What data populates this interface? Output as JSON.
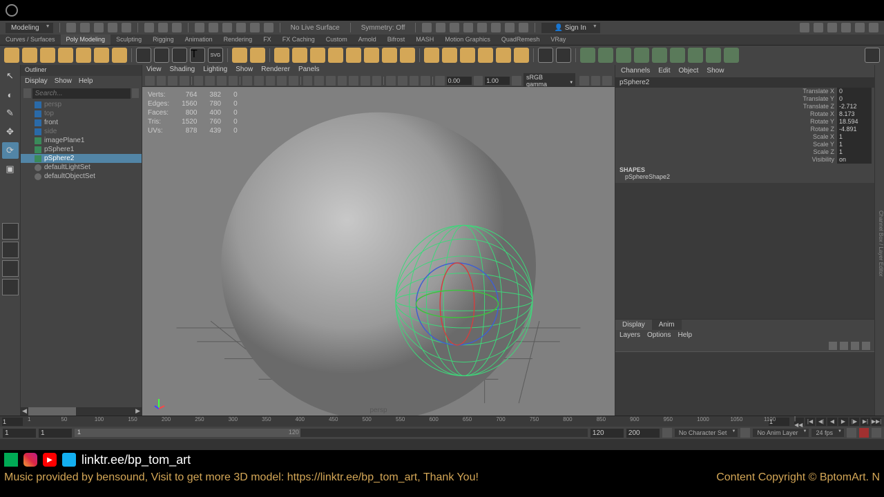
{
  "menubar": {
    "workspace": "Modeling",
    "liveSurface": "No Live Surface",
    "symmetry": "Symmetry: Off",
    "signIn": "Sign In"
  },
  "shelfTabs": [
    "Curves / Surfaces",
    "Poly Modeling",
    "Sculpting",
    "Rigging",
    "Animation",
    "Rendering",
    "FX",
    "FX Caching",
    "Custom",
    "Arnold",
    "Bifrost",
    "MASH",
    "Motion Graphics",
    "QuadRemesh",
    "VRay"
  ],
  "activeShelfTab": 1,
  "outliner": {
    "title": "Outliner",
    "menu": [
      "Display",
      "Show",
      "Help"
    ],
    "searchPlaceholder": "Search...",
    "items": [
      {
        "label": "persp",
        "type": "cam",
        "dim": true
      },
      {
        "label": "top",
        "type": "cam",
        "dim": true
      },
      {
        "label": "front",
        "type": "cam",
        "dim": false
      },
      {
        "label": "side",
        "type": "cam",
        "dim": true
      },
      {
        "label": "imagePlane1",
        "type": "mesh",
        "dim": false
      },
      {
        "label": "pSphere1",
        "type": "mesh",
        "dim": false
      },
      {
        "label": "pSphere2",
        "type": "mesh",
        "dim": false,
        "sel": true
      },
      {
        "label": "defaultLightSet",
        "type": "set",
        "dim": false
      },
      {
        "label": "defaultObjectSet",
        "type": "set",
        "dim": false
      }
    ]
  },
  "viewport": {
    "menu": [
      "View",
      "Shading",
      "Lighting",
      "Show",
      "Renderer",
      "Panels"
    ],
    "exposure": "0.00",
    "gammaVal": "1.00",
    "gamma": "sRGB gamma",
    "cameraLabel": "persp",
    "hud": {
      "rows": [
        {
          "k": "Verts:",
          "a": "764",
          "b": "382",
          "c": "0"
        },
        {
          "k": "Edges:",
          "a": "1560",
          "b": "780",
          "c": "0"
        },
        {
          "k": "Faces:",
          "a": "800",
          "b": "400",
          "c": "0"
        },
        {
          "k": "Tris:",
          "a": "1520",
          "b": "760",
          "c": "0"
        },
        {
          "k": "UVs:",
          "a": "878",
          "b": "439",
          "c": "0"
        }
      ]
    }
  },
  "channelBox": {
    "menu": [
      "Channels",
      "Edit",
      "Object",
      "Show"
    ],
    "objectName": "pSphere2",
    "attrs": [
      {
        "l": "Translate X",
        "v": "0"
      },
      {
        "l": "Translate Y",
        "v": "0"
      },
      {
        "l": "Translate Z",
        "v": "-2.712"
      },
      {
        "l": "Rotate X",
        "v": "8.173"
      },
      {
        "l": "Rotate Y",
        "v": "18.594"
      },
      {
        "l": "Rotate Z",
        "v": "-4.891"
      },
      {
        "l": "Scale X",
        "v": "1"
      },
      {
        "l": "Scale Y",
        "v": "1"
      },
      {
        "l": "Scale Z",
        "v": "1"
      },
      {
        "l": "Visibility",
        "v": "on"
      }
    ],
    "shapesHdr": "SHAPES",
    "shapeName": "pSphereShape2",
    "layerTabs": [
      "Display",
      "Anim"
    ],
    "layerMenu": [
      "Layers",
      "Options",
      "Help"
    ]
  },
  "timeline": {
    "ticks": [
      "1",
      "50",
      "100",
      "150",
      "200",
      "250",
      "300",
      "350",
      "400",
      "450",
      "500",
      "550",
      "600",
      "650",
      "700",
      "750",
      "800",
      "850",
      "900",
      "950",
      "1000",
      "1050",
      "1100"
    ],
    "curFrame": "1"
  },
  "range": {
    "start": "1",
    "minStart": "1",
    "sliderEnd": "120",
    "end": "120",
    "max": "200",
    "charSet": "No Character Set",
    "animLayer": "No Anim Layer",
    "fps": "24 fps"
  },
  "footer": {
    "link": "linktr.ee/bp_tom_art",
    "music": "Music provided by bensound, Visit to get more 3D model: https://linktr.ee/bp_tom_art, Thank You!",
    "copyright": "Content Copyright © BptomArt. N"
  }
}
